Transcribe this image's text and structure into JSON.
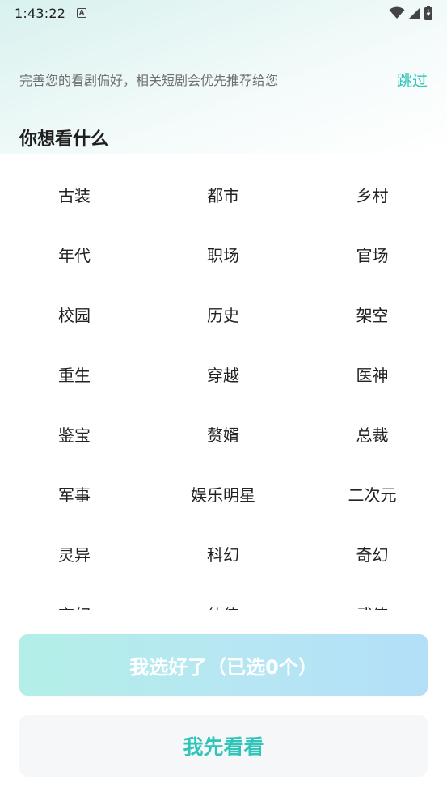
{
  "status_bar": {
    "time": "1:43:22",
    "notification_icon": "a-box-icon",
    "icons": [
      "wifi-icon",
      "signal-icon",
      "battery-charging-icon"
    ]
  },
  "header": {
    "prompt": "完善您的看剧偏好，相关短剧会优先推荐给您",
    "skip_label": "跳过"
  },
  "section_title": "你想看什么",
  "genres": [
    "古装",
    "都市",
    "乡村",
    "年代",
    "职场",
    "官场",
    "校园",
    "历史",
    "架空",
    "重生",
    "穿越",
    "医神",
    "鉴宝",
    "赘婿",
    "总裁",
    "军事",
    "娱乐明星",
    "二次元",
    "灵异",
    "科幻",
    "奇幻",
    "玄幻",
    "仙侠",
    "武侠"
  ],
  "buttons": {
    "confirm_label": "我选好了（已选0个）",
    "browse_label": "我先看看"
  },
  "colors": {
    "accent": "#2fc5b8",
    "confirm_gradient_start": "#b3efe7",
    "confirm_gradient_end": "#b3dff8",
    "secondary_bg": "#f6f7f9"
  }
}
